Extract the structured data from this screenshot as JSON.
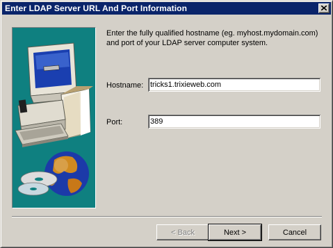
{
  "window": {
    "title": "Enter LDAP Server URL And Port Information"
  },
  "intro": "Enter the fully qualified hostname (eg. myhost.mydomain.com) and port of your LDAP server computer system.",
  "hostname": {
    "label": "Hostname:",
    "value": "tricks1.trixieweb.com"
  },
  "port": {
    "label": "Port:",
    "value": "389"
  },
  "buttons": {
    "back": "< Back",
    "next": "Next >",
    "cancel": "Cancel"
  },
  "icons": {
    "close": "close-icon",
    "art": "computer-setup-illustration"
  },
  "colors": {
    "titlebar": "#0a246a",
    "panel": "#0f8080",
    "face": "#d4d0c8"
  }
}
